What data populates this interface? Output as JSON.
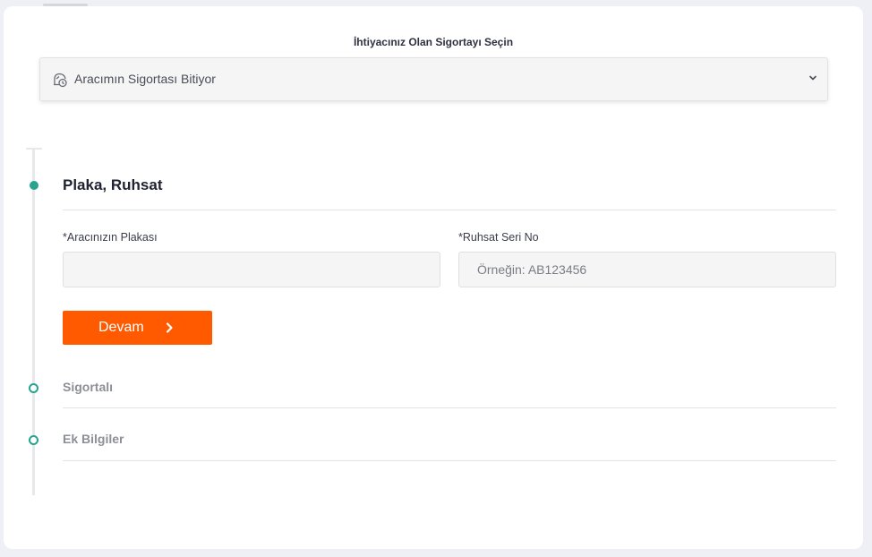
{
  "insurance_select": {
    "title": "İhtiyacınız Olan Sigortayı Seçin",
    "selected_value": "Aracımın Sigortası Bitiyor",
    "icon": "car-clock-icon",
    "chevron_icon": "chevron-down-icon"
  },
  "steps": [
    {
      "title": "Plaka, Ruhsat",
      "state": "active",
      "fields": [
        {
          "label": "*Aracınızın Plakası",
          "value": "",
          "placeholder": ""
        },
        {
          "label": "*Ruhsat Seri No",
          "value": "",
          "placeholder": "Örneğin: AB123456"
        }
      ],
      "continue_label": "Devam"
    },
    {
      "title": "Sigortalı",
      "state": "pending"
    },
    {
      "title": "Ek Bilgiler",
      "state": "pending"
    }
  ],
  "colors": {
    "accent_orange": "#ff5a00",
    "step_teal": "#27a38f"
  }
}
